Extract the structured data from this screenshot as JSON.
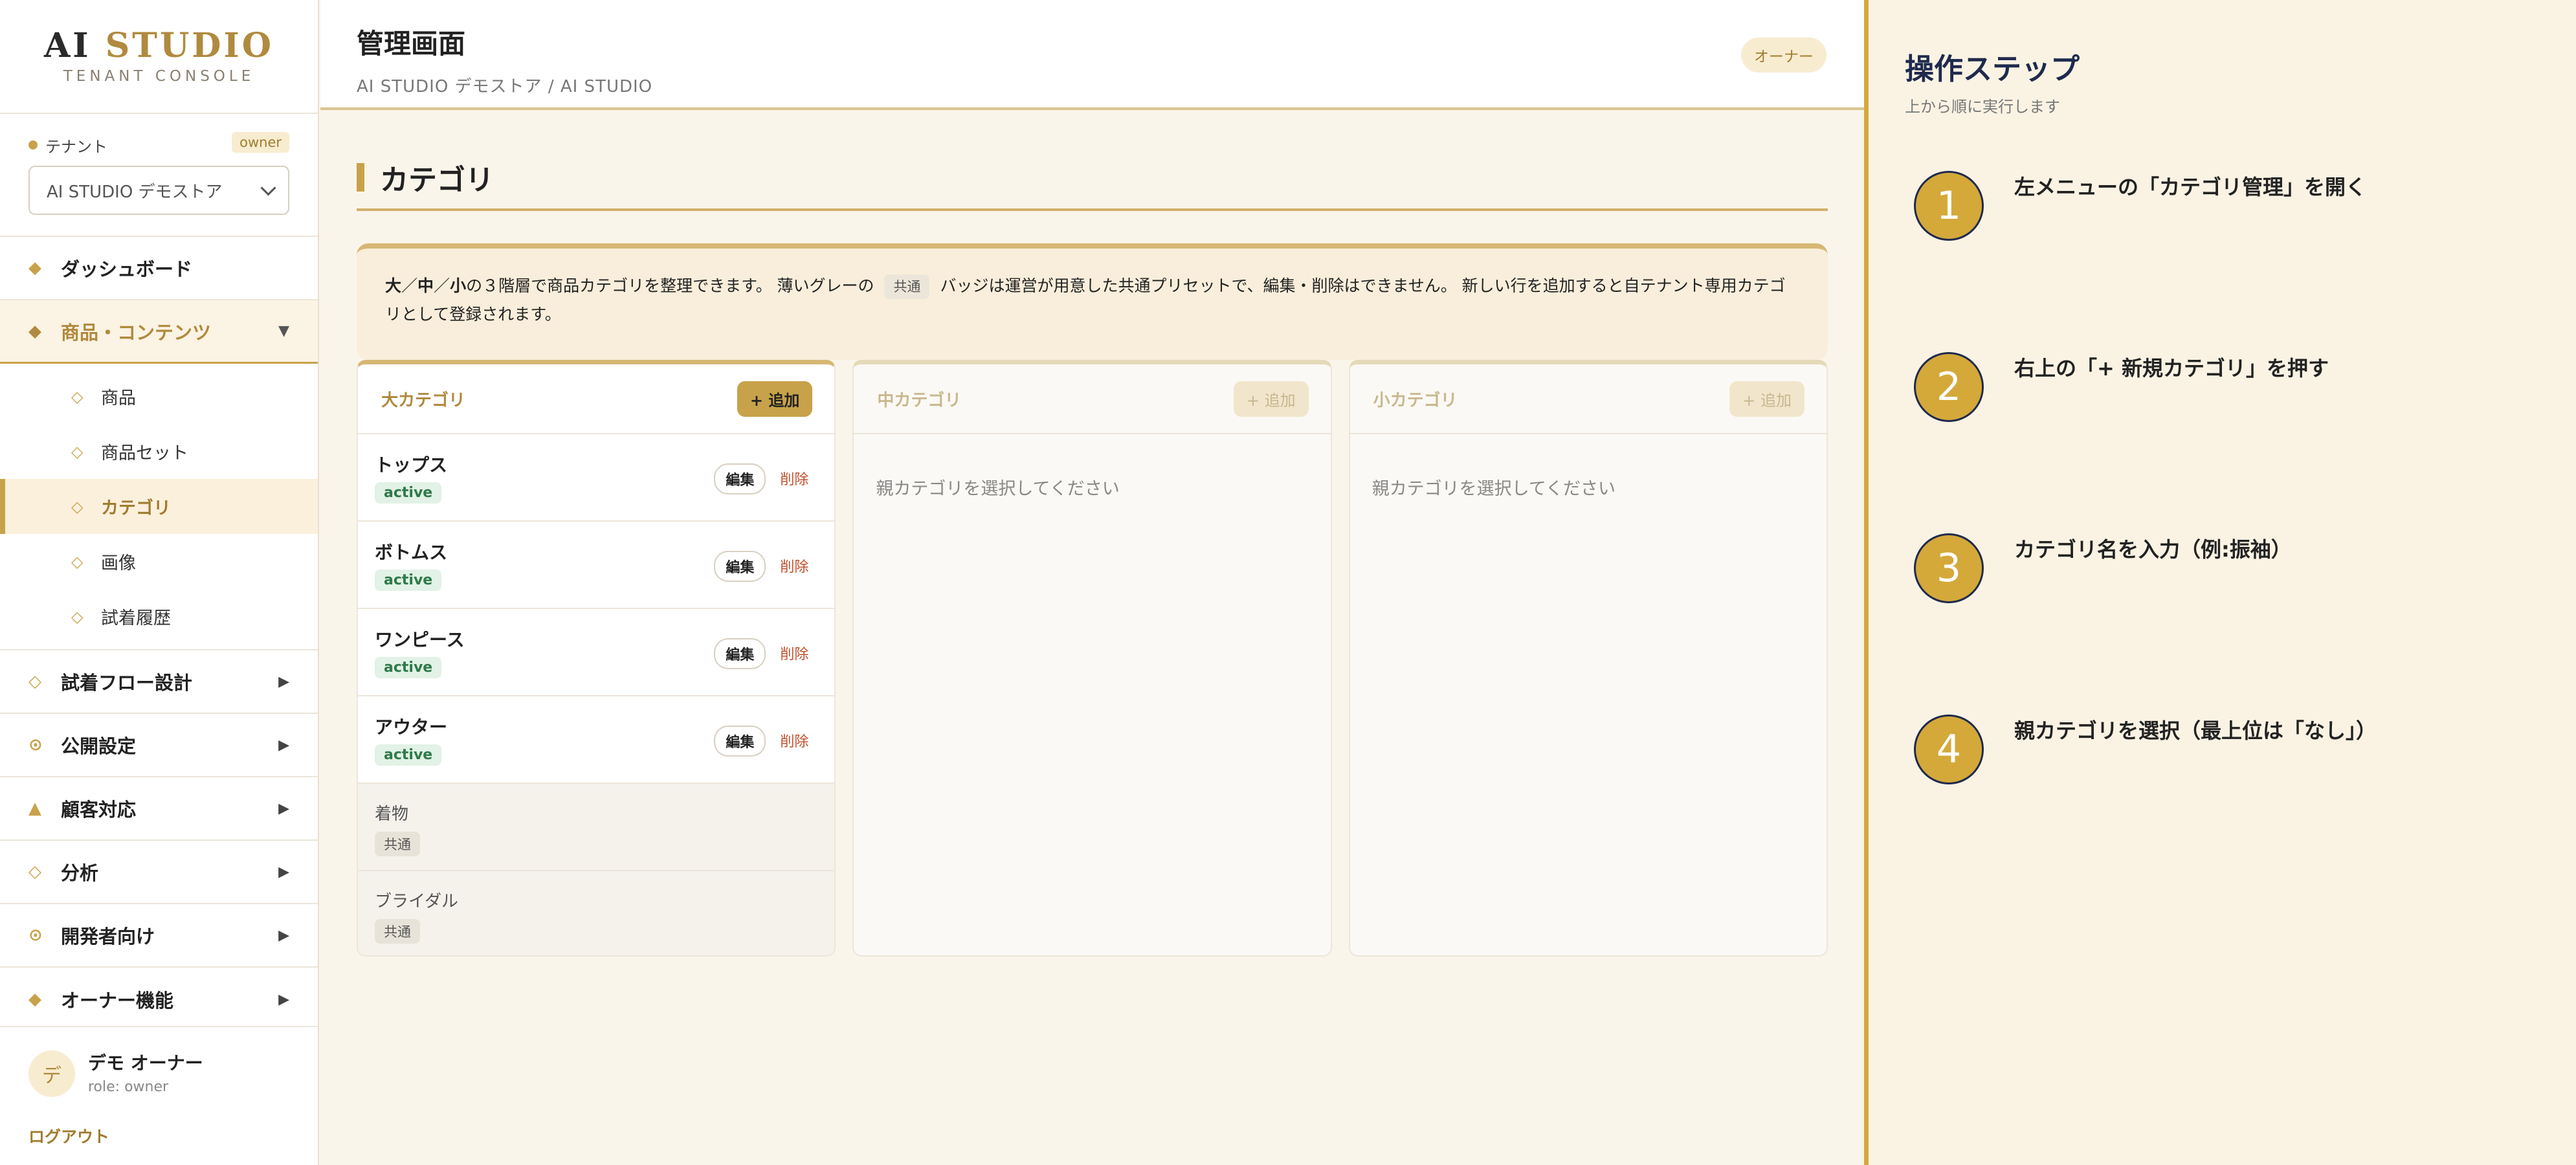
{
  "brand": {
    "title_main": "AI",
    "title_accent": "STUDIO",
    "subtitle": "TENANT CONSOLE"
  },
  "tenant": {
    "label": "テナント",
    "role_badge": "owner",
    "selected": "AI STUDIO デモストア"
  },
  "nav": {
    "dashboard": "ダッシュボード",
    "products_group": "商品・コンテンツ",
    "sub": [
      "商品",
      "商品セット",
      "カテゴリ",
      "画像",
      "試着履歴"
    ],
    "tryon_flow": "試着フロー設計",
    "publish": "公開設定",
    "support": "顧客対応",
    "analytics": "分析",
    "developer": "開発者向け",
    "owner": "オーナー機能"
  },
  "user": {
    "avatar": "デ",
    "name": "デモ オーナー",
    "role": "role: owner",
    "logout": "ログアウト"
  },
  "header": {
    "title": "管理画面",
    "breadcrumb": "AI STUDIO デモストア / AI STUDIO",
    "role_pill": "オーナー"
  },
  "page": {
    "title": "カテゴリ",
    "info": {
      "b1": "大",
      "s1": "／",
      "b2": "中",
      "s2": "／",
      "b3": "小",
      "t1": "の３階層で商品カテゴリを整理できます。 薄いグレーの",
      "chip": "共通",
      "t2": "バッジは運営が用意した共通プリセットで、編集・削除はできません。 新しい行を追加すると自テナント専用カテゴリとして登録されます。"
    }
  },
  "columns": {
    "large": {
      "title": "大カテゴリ",
      "add": "+ 追加",
      "rows": [
        {
          "name": "トップス",
          "status": "active",
          "edit": "編集",
          "delete": "削除"
        },
        {
          "name": "ボトムス",
          "status": "active",
          "edit": "編集",
          "delete": "削除"
        },
        {
          "name": "ワンピース",
          "status": "active",
          "edit": "編集",
          "delete": "削除"
        },
        {
          "name": "アウター",
          "status": "active",
          "edit": "編集",
          "delete": "削除"
        }
      ],
      "shared_rows": [
        {
          "name": "着物",
          "badge": "共通"
        },
        {
          "name": "ブライダル",
          "badge": "共通"
        }
      ]
    },
    "medium": {
      "title": "中カテゴリ",
      "add": "+ 追加",
      "placeholder": "親カテゴリを選択してください"
    },
    "small": {
      "title": "小カテゴリ",
      "add": "+ 追加",
      "placeholder": "親カテゴリを選択してください"
    }
  },
  "steps": {
    "title": "操作ステップ",
    "subtitle": "上から順に実行します",
    "items": [
      {
        "num": "1",
        "text": "左メニューの「カテゴリ管理」を開く"
      },
      {
        "num": "2",
        "text": "右上の「+ 新規カテゴリ」を押す"
      },
      {
        "num": "3",
        "text": "カテゴリ名を入力（例:振袖）"
      },
      {
        "num": "4",
        "text": "親カテゴリを選択（最上位は「なし」）"
      }
    ]
  },
  "colors": {
    "accent": "#c8a24a",
    "step_circle": "#d4a93a",
    "navy": "#1f2a4d",
    "danger": "#c0502c",
    "success": "#2f7a4a"
  }
}
